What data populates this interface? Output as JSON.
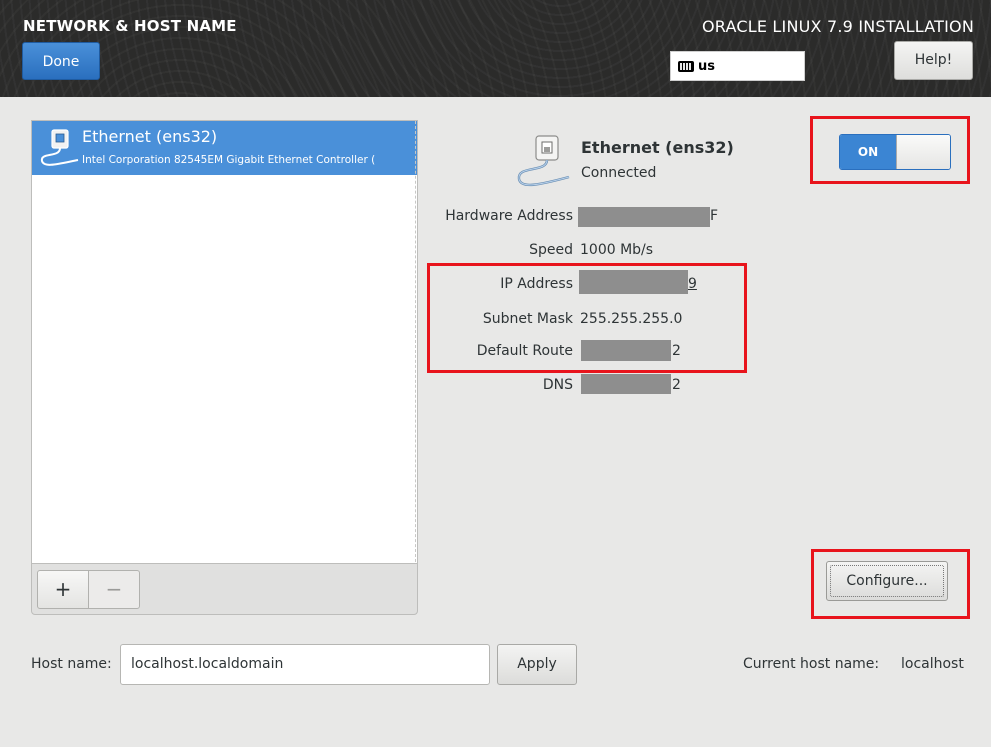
{
  "header": {
    "spoke_title": "NETWORK & HOST NAME",
    "done_label": "Done",
    "product_title": "ORACLE LINUX 7.9 INSTALLATION",
    "keyboard_layout": "us",
    "help_label": "Help!"
  },
  "device_list": {
    "items": [
      {
        "name": "Ethernet (ens32)",
        "description": "Intel Corporation 82545EM Gigabit Ethernet Controller (",
        "selected": true
      }
    ],
    "add_label": "+",
    "remove_label": "−"
  },
  "device_details": {
    "name": "Ethernet (ens32)",
    "status": "Connected",
    "switch_label": "ON",
    "switch_state": "on",
    "properties": {
      "hardware_address": {
        "label": "Hardware Address",
        "visible_tail": "F",
        "redacted": true
      },
      "speed": {
        "label": "Speed",
        "value": "1000 Mb/s"
      },
      "ip_address": {
        "label": "IP Address",
        "visible_tail": "9",
        "redacted": true
      },
      "subnet_mask": {
        "label": "Subnet Mask",
        "value": "255.255.255.0"
      },
      "default_route": {
        "label": "Default Route",
        "visible_tail": "2",
        "redacted": true
      },
      "dns": {
        "label": "DNS",
        "visible_tail": "2",
        "redacted": true
      }
    },
    "configure_label": "Configure..."
  },
  "hostname": {
    "label": "Host name:",
    "value": "localhost.localdomain",
    "apply_label": "Apply",
    "current_label": "Current host name:",
    "current_value": "localhost"
  },
  "colors": {
    "accent_blue": "#4a90d9",
    "header_bg": "#2b2b2a",
    "highlight_red": "#e8141c",
    "redaction_gray": "#8e8e8e"
  }
}
